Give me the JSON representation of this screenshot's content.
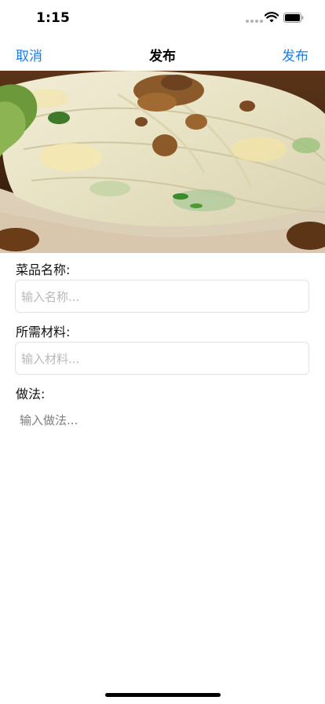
{
  "status_bar": {
    "time": "1:15",
    "wifi_icon": "wifi-icon",
    "battery_icon": "battery-icon"
  },
  "nav": {
    "cancel_label": "取消",
    "title": "发布",
    "publish_label": "发布"
  },
  "photo": {
    "description_icon": "dish-photo"
  },
  "form": {
    "name_label": "菜品名称:",
    "name_placeholder": "输入名称...",
    "ingredients_label": "所需材料:",
    "ingredients_placeholder": "输入材料...",
    "method_label": "做法:",
    "method_placeholder": "输入做法..."
  },
  "colors": {
    "accent": "#1a7cf2",
    "placeholder": "#b8b8b8",
    "border": "#e3e3e3"
  }
}
